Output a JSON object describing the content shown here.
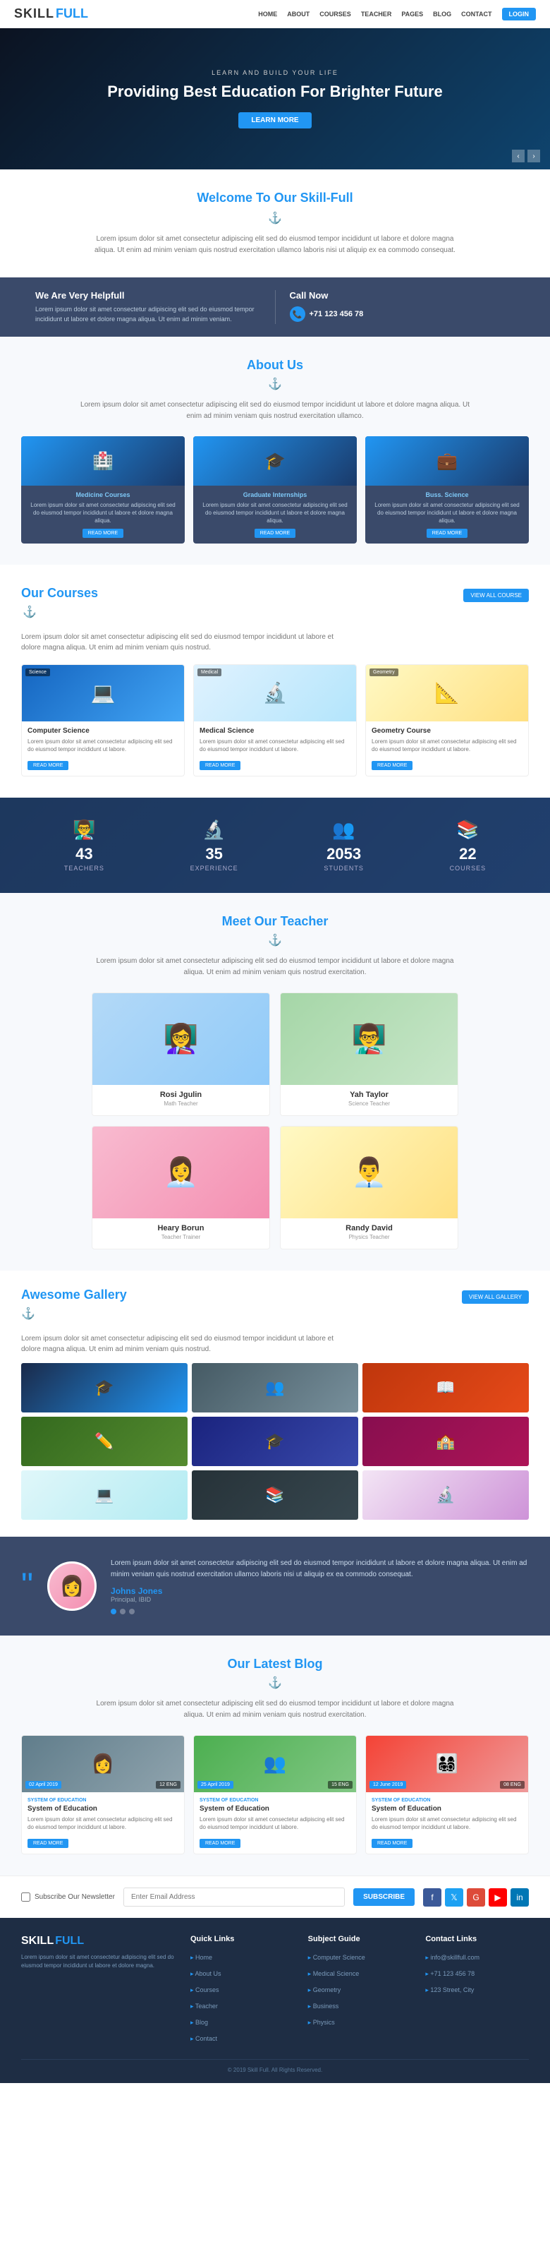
{
  "navbar": {
    "logo_skill": "SKILL",
    "logo_full": "FULL",
    "nav_items": [
      "HOME",
      "ABOUT",
      "COURSES",
      "TEACHER",
      "PAGES",
      "BLOG",
      "CONTACT"
    ],
    "login_label": "LOGIN"
  },
  "hero": {
    "sub_text": "LEARN AND BUILD YOUR LIFE",
    "title": "Providing Best Education For Brighter Future",
    "btn_label": "LEARN MORE"
  },
  "welcome": {
    "title_start": "Welcome To Our ",
    "title_brand": "Skill-Full",
    "body_text": "Lorem ipsum dolor sit amet consectetur adipiscing elit sed do eiusmod tempor incididunt ut labore et dolore magna aliqua. Ut enim ad minim veniam quis nostrud exercitation ullamco laboris nisi ut aliquip ex ea commodo consequat."
  },
  "info_helpful": {
    "title": "We Are Very Helpfull",
    "text": "Lorem ipsum dolor sit amet consectetur adipiscing elit sed do eiusmod tempor incididunt ut labore et dolore magna aliqua. Ut enim ad minim veniam."
  },
  "info_call": {
    "title": "Call Now",
    "phone": "+71 123 456 78"
  },
  "about": {
    "title_start": "About ",
    "title_accent": "Us",
    "text": "Lorem ipsum dolor sit amet consectetur adipiscing elit sed do eiusmod tempor incididunt ut labore et dolore magna aliqua. Ut enim ad minim veniam quis nostrud exercitation ullamco.",
    "cards": [
      {
        "title": "Medicine Courses",
        "text": "Lorem ipsum dolor sit amet consectetur adipiscing elit sed do eiusmod tempor incididunt ut labore et dolore magna aliqua.",
        "btn": "READ MORE"
      },
      {
        "title": "Graduate Internships",
        "text": "Lorem ipsum dolor sit amet consectetur adipiscing elit sed do eiusmod tempor incididunt ut labore et dolore magna aliqua.",
        "btn": "READ MORE"
      },
      {
        "title": "Buss. Science",
        "text": "Lorem ipsum dolor sit amet consectetur adipiscing elit sed do eiusmod tempor incididunt ut labore et dolore magna aliqua.",
        "btn": "READ MORE"
      }
    ]
  },
  "courses": {
    "title_start": "Our ",
    "title_accent": "Courses",
    "view_all": "VIEW ALL COURSE",
    "text": "Lorem ipsum dolor sit amet consectetur adipiscing elit sed do eiusmod tempor incididunt ut labore et dolore magna aliqua. Ut enim ad minim veniam quis nostrud.",
    "items": [
      {
        "name": "Computer Science",
        "desc": "Lorem ipsum dolor sit amet consectetur adipiscing elit sed do eiusmod tempor incididunt ut labore.",
        "btn": "READ MORE",
        "label": "Science"
      },
      {
        "name": "Medical Science",
        "desc": "Lorem ipsum dolor sit amet consectetur adipiscing elit sed do eiusmod tempor incididunt ut labore.",
        "btn": "READ MORE",
        "label": "Medical"
      },
      {
        "name": "Geometry Course",
        "desc": "Lorem ipsum dolor sit amet consectetur adipiscing elit sed do eiusmod tempor incididunt ut labore.",
        "btn": "READ MORE",
        "label": "Geometry"
      }
    ]
  },
  "stats": {
    "items": [
      {
        "num": "43",
        "label": "TEACHERS"
      },
      {
        "num": "35",
        "label": "EXPERIENCE"
      },
      {
        "num": "2053",
        "label": "STUDENTS"
      },
      {
        "num": "22",
        "label": "COURSES"
      }
    ]
  },
  "teachers": {
    "title_start": "Meet Our ",
    "title_accent": "Teacher",
    "text": "Lorem ipsum dolor sit amet consectetur adipiscing elit sed do eiusmod tempor incididunt ut labore et dolore magna aliqua. Ut enim ad minim veniam quis nostrud exercitation.",
    "items": [
      {
        "name": "Rosi Jgulin",
        "role": "Math Teacher"
      },
      {
        "name": "Yah Taylor",
        "role": "Science Teacher"
      },
      {
        "name": "Heary Borun",
        "role": "Teacher Trainer"
      },
      {
        "name": "Randy David",
        "role": "Physics Teacher"
      }
    ]
  },
  "gallery": {
    "title_start": "Awesome ",
    "title_accent": "Gallery",
    "view_all": "VIEW ALL GALLERY",
    "text": "Lorem ipsum dolor sit amet consectetur adipiscing elit sed do eiusmod tempor incididunt ut labore et dolore magna aliqua. Ut enim ad minim veniam quis nostrud."
  },
  "testimonial": {
    "text": "Lorem ipsum dolor sit amet consectetur adipiscing elit sed do eiusmod tempor incididunt ut labore et dolore magna aliqua. Ut enim ad minim veniam quis nostrud exercitation ullamco laboris nisi ut aliquip ex ea commodo consequat.",
    "name": "Johns Jones",
    "role": "Principal, IBID"
  },
  "blog": {
    "title_start": "Our Latest ",
    "title_accent": "Blog",
    "text": "Lorem ipsum dolor sit amet consectetur adipiscing elit sed do eiusmod tempor incididunt ut labore et dolore magna aliqua. Ut enim ad minim veniam quis nostrud exercitation.",
    "items": [
      {
        "category": "SYSTEM OF EDUCATION",
        "name": "System of Education",
        "desc": "Lorem ipsum dolor sit amet consectetur adipiscing elit sed do eiusmod tempor incididunt ut labore.",
        "date": "02 April 2019",
        "comments": "12 ENG",
        "btn": "READ MORE"
      },
      {
        "category": "SYSTEM OF EDUCATION",
        "name": "System of Education",
        "desc": "Lorem ipsum dolor sit amet consectetur adipiscing elit sed do eiusmod tempor incididunt ut labore.",
        "date": "25 April 2019",
        "comments": "15 ENG",
        "btn": "READ MORE"
      },
      {
        "category": "SYSTEM OF EDUCATION",
        "name": "System of Education",
        "desc": "Lorem ipsum dolor sit amet consectetur adipiscing elit sed do eiusmod tempor incididunt ut labore.",
        "date": "12 June 2019",
        "comments": "08 ENG",
        "btn": "READ MORE"
      }
    ]
  },
  "newsletter": {
    "checkbox_label": "Subscribe Our Newsletter",
    "input_placeholder": "Enter Email Address",
    "btn_label": "SUBSCRIBE"
  },
  "footer": {
    "skill": "SKILL",
    "full": "FULL",
    "desc": "Lorem ipsum dolor sit amet consectetur adipiscing elit sed do eiusmod tempor incididunt ut labore et dolore magna.",
    "quick_links_title": "Quick Links",
    "quick_links": [
      "Home",
      "About Us",
      "Courses",
      "Teacher",
      "Blog",
      "Contact"
    ],
    "subject_guide_title": "Subject Guide",
    "subject_guide": [
      "Computer Science",
      "Medical Science",
      "Geometry",
      "Business",
      "Physics"
    ],
    "contact_title": "Contact Links",
    "contacts": [
      "info@skillfull.com",
      "+71 123 456 78",
      "123 Street, City"
    ],
    "copyright": "© 2019 Skill Full. All Rights Reserved."
  }
}
